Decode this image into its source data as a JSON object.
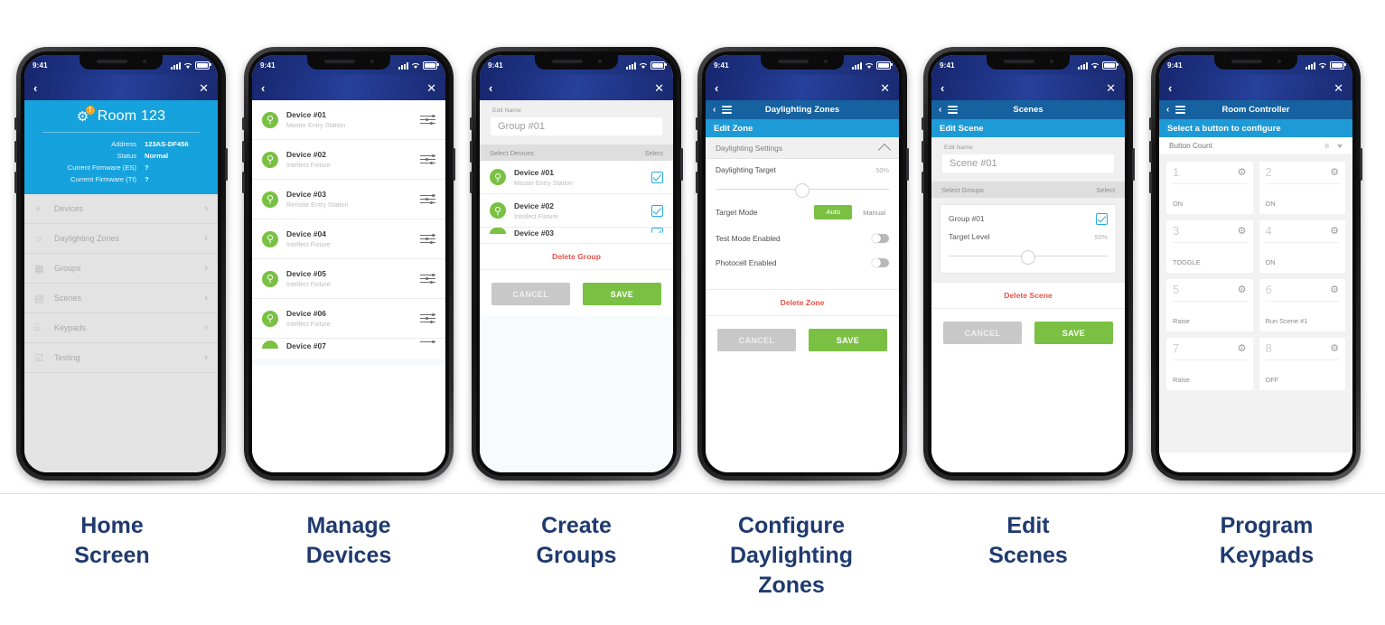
{
  "status_bar": {
    "time": "9:41",
    "signal_icon": "signal-bars-icon",
    "wifi_icon": "wifi-icon",
    "battery_icon": "battery-icon"
  },
  "nav": {
    "back_icon": "‹",
    "close_icon": "✕"
  },
  "screens": [
    {
      "caption": "Home\nScreen",
      "hero": {
        "title": "Room 123",
        "badge": "!",
        "gear_icon": "gear-icon",
        "rows": [
          {
            "key": "Address",
            "value": "123AS-DF456"
          },
          {
            "key": "Status",
            "value": "Normal"
          },
          {
            "key": "Current Firmware (ES)",
            "value": "?"
          },
          {
            "key": "Current Firmware (TI)",
            "value": "?"
          }
        ]
      },
      "menu": [
        {
          "label": "Devices",
          "icon": "bolt-icon",
          "glyph": "⚡"
        },
        {
          "label": "Daylighting Zones",
          "icon": "sun-icon",
          "glyph": "☼"
        },
        {
          "label": "Groups",
          "icon": "groups-icon",
          "glyph": "▦"
        },
        {
          "label": "Scenes",
          "icon": "scenes-icon",
          "glyph": "▤"
        },
        {
          "label": "Keypads",
          "icon": "keypad-icon",
          "glyph": "⌸"
        },
        {
          "label": "Testing",
          "icon": "clipboard-check-icon",
          "glyph": "☑"
        }
      ],
      "chevron": "›"
    },
    {
      "caption": "Manage\nDevices",
      "devices": [
        {
          "name": "Device #01",
          "sub": "Master Entry Station"
        },
        {
          "name": "Device #02",
          "sub": "Intellect Fixture"
        },
        {
          "name": "Device #03",
          "sub": "Remote Entry Station"
        },
        {
          "name": "Device #04",
          "sub": "Intellect Fixture"
        },
        {
          "name": "Device #05",
          "sub": "Intellect Fixture"
        },
        {
          "name": "Device #06",
          "sub": "Intellect Fixture"
        },
        {
          "name": "Device #07",
          "sub": ""
        }
      ],
      "device_icon": "magnifier-circle-icon",
      "row_action_icon": "sliders-icon"
    },
    {
      "caption": "Create\nGroups",
      "edit_name_label": "Edit Name",
      "name_value": "Group #01",
      "section_left": "Select Devices",
      "section_right": "Select",
      "devices": [
        {
          "name": "Device #01",
          "sub": "Master Entry Station",
          "checked": true
        },
        {
          "name": "Device #02",
          "sub": "Intellect Fixture",
          "checked": true
        },
        {
          "name": "Device #03",
          "sub": "",
          "checked": true
        }
      ],
      "delete_label": "Delete Group",
      "cancel_label": "CANCEL",
      "save_label": "SAVE"
    },
    {
      "caption": "Configure\nDaylighting\nZones",
      "subnav_title": "Daylighting Zones",
      "bluebar": "Edit Zone",
      "accordion": "Daylighting Settings",
      "target_label": "Daylighting Target",
      "target_value": "50%",
      "target_mode_label": "Target Mode",
      "mode_auto": "Auto",
      "mode_manual": "Manual",
      "test_mode_label": "Test Mode Enabled",
      "photocell_label": "Photocell Enabled",
      "delete_label": "Delete Zone",
      "cancel_label": "CANCEL",
      "save_label": "SAVE"
    },
    {
      "caption": "Edit\nScenes",
      "subnav_title": "Scenes",
      "bluebar": "Edit Scene",
      "edit_name_label": "Edit Name",
      "name_value": "Scene #01",
      "section_left": "Select Groups",
      "section_right": "Select",
      "group_name": "Group #01",
      "target_level_label": "Target Level",
      "target_level_value": "50%",
      "delete_label": "Delete Scene",
      "cancel_label": "CANCEL",
      "save_label": "SAVE"
    },
    {
      "caption": "Program\nKeypads",
      "subnav_title": "Room Controller",
      "bluebar": "Select a button to configure",
      "button_count_label": "Button Count",
      "button_count_value": "8",
      "buttons": [
        {
          "num": "1",
          "action": "ON"
        },
        {
          "num": "2",
          "action": "ON"
        },
        {
          "num": "3",
          "action": "TOGGLE"
        },
        {
          "num": "4",
          "action": "ON"
        },
        {
          "num": "5",
          "action": "Raise"
        },
        {
          "num": "6",
          "action": "Run Scene #1"
        },
        {
          "num": "7",
          "action": "Raise"
        },
        {
          "num": "8",
          "action": "OFF"
        }
      ],
      "gear_icon": "gear-icon"
    }
  ],
  "colors": {
    "navy": "#1b2a72",
    "blue_header": "#16619f",
    "light_blue": "#1e9ad6",
    "hero_blue": "#16a2dc",
    "green": "#7ac143",
    "red": "#e8524a",
    "caption": "#1f3a6e",
    "badge_orange": "#f5a623"
  }
}
